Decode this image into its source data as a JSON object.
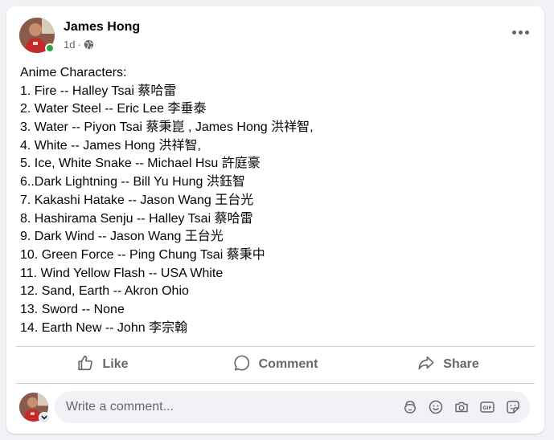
{
  "post": {
    "author": "James Hong",
    "time": "1d",
    "separator": "·",
    "lines": [
      "Anime Characters:",
      "1. Fire -- Halley Tsai 蔡哈雷",
      "2. Water Steel -- Eric Lee 李垂泰",
      "3. Water -- Piyon Tsai 蔡秉崑 , James Hong 洪祥智,",
      "4. White --  James Hong 洪祥智,",
      "5. Ice, White Snake -- Michael Hsu 許庭豪",
      "6..Dark Lightning -- Bill Yu Hung 洪鈺智",
      "7. Kakashi Hatake -- Jason Wang 王台光",
      "8. Hashirama Senju -- Halley Tsai 蔡哈雷",
      "9. Dark Wind -- Jason Wang 王台光",
      "10. Green Force -- Ping Chung Tsai 蔡秉中",
      "11. Wind Yellow Flash -- USA White",
      "12. Sand, Earth -- Akron Ohio",
      "13. Sword -- None",
      "14. Earth New -- John 李宗翰"
    ]
  },
  "actions": {
    "like": "Like",
    "comment": "Comment",
    "share": "Share"
  },
  "comment_box": {
    "placeholder": "Write a comment..."
  },
  "icons": {
    "more": "more-options-icon",
    "audience": "globe-icon",
    "like": "thumbs-up-icon",
    "comment": "speech-bubble-icon",
    "share": "share-arrow-icon",
    "avatar_sticker": "avatar-sticker-icon",
    "emoji": "smiley-icon",
    "camera": "camera-icon",
    "gif": "gif-icon",
    "sticker": "sticker-icon"
  },
  "colors": {
    "online": "#31a24c",
    "secondary_text": "#65676b",
    "primary_text": "#050505"
  }
}
